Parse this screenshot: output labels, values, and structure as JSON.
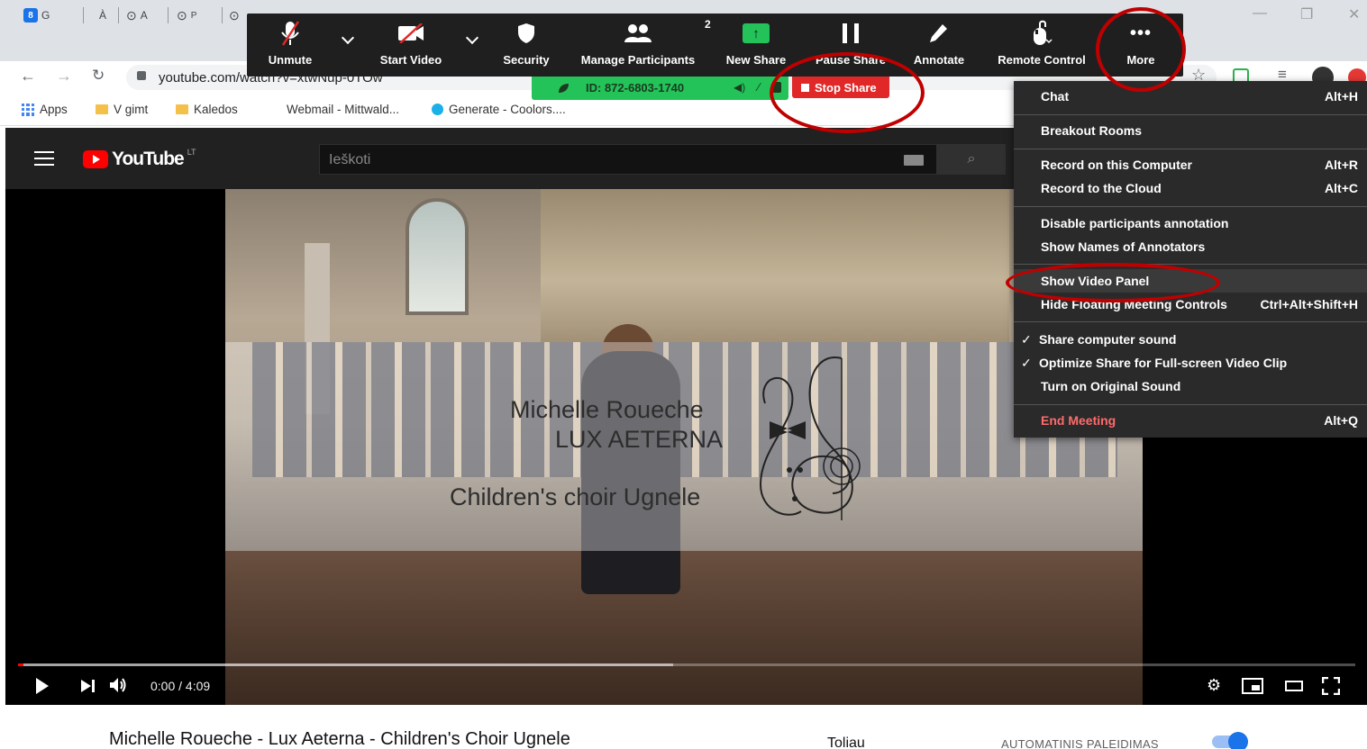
{
  "browser": {
    "tabs": [
      {
        "label": "G",
        "favicon_color": "#1a73e8",
        "favicon_text": "8"
      },
      {
        "label": "À",
        "favicon_color": "#dee1e6",
        "favicon_text": ""
      },
      {
        "label": "A",
        "favicon_color": "#444444",
        "favicon_text": "⊙"
      },
      {
        "label": "P",
        "favicon_color": "#444444",
        "favicon_text": "⊙"
      }
    ],
    "url_display": "youtube.com/watch?v=xtwNup-0TOw",
    "bookmarks": [
      "Apps",
      "V gimt",
      "Kaledos",
      "Webmail - Mittwald...",
      "Generate - Coolors...."
    ],
    "window_controls": [
      "—",
      "❐",
      "✕"
    ]
  },
  "youtube": {
    "logo_text": "YouTube",
    "logo_region": "LT",
    "search_placeholder": "Ieškoti",
    "video_overlay": {
      "line1": "Michelle Roueche",
      "line2": "LUX AETERNA",
      "line3": "Children's choir Ugnele"
    },
    "time": "0:00 / 4:09",
    "progress_fraction": 0.0,
    "buffered_fraction": 0.49,
    "video_title": "Michelle Roueche - Lux Aeterna - Children's Choir Ugnele",
    "up_next_label": "Toliau",
    "autoplay_label": "AUTOMATINIS PALEIDIMAS",
    "autoplay_on": true
  },
  "zoom": {
    "toolbar": [
      {
        "label": "Unmute",
        "icon": "muted-mic-icon"
      },
      {
        "label": "Start Video",
        "icon": "video-off-icon"
      },
      {
        "label": "Security",
        "icon": "shield-icon"
      },
      {
        "label": "Manage Participants",
        "icon": "participants-icon",
        "count": "2"
      },
      {
        "label": "New Share",
        "icon": "share-arrow-icon"
      },
      {
        "label": "Pause Share",
        "icon": "pause-icon"
      },
      {
        "label": "Annotate",
        "icon": "pencil-icon"
      },
      {
        "label": "Remote Control",
        "icon": "mouse-icon"
      },
      {
        "label": "More",
        "icon": "ellipsis-icon"
      }
    ],
    "meeting_id": "ID: 872-6803-1740",
    "stop_share_label": "Stop Share",
    "more_menu": [
      {
        "label": "Chat",
        "shortcut": "Alt+H",
        "checked": false
      },
      {
        "label": "Breakout Rooms",
        "shortcut": "",
        "checked": false
      },
      {
        "label": "Record on this Computer",
        "shortcut": "Alt+R",
        "checked": false
      },
      {
        "label": "Record to the Cloud",
        "shortcut": "Alt+C",
        "checked": false
      },
      {
        "label": "Disable participants annotation",
        "shortcut": "",
        "checked": false
      },
      {
        "label": "Show Names of Annotators",
        "shortcut": "",
        "checked": false
      },
      {
        "label": "Show Video Panel",
        "shortcut": "",
        "checked": false
      },
      {
        "label": "Hide Floating Meeting Controls",
        "shortcut": "Ctrl+Alt+Shift+H",
        "checked": false
      },
      {
        "label": "Share computer sound",
        "shortcut": "",
        "checked": true
      },
      {
        "label": "Optimize Share for Full-screen Video Clip",
        "shortcut": "",
        "checked": true
      },
      {
        "label": "Turn on Original Sound",
        "shortcut": "",
        "checked": false
      },
      {
        "label": "End Meeting",
        "shortcut": "Alt+Q",
        "checked": false
      }
    ],
    "colors": {
      "toolbar_bg": "#1f1f1f",
      "share_green": "#23c35a",
      "stop_red": "#e02828",
      "end_meeting": "#ff6b6b",
      "annotation_red": "#c00000"
    }
  }
}
